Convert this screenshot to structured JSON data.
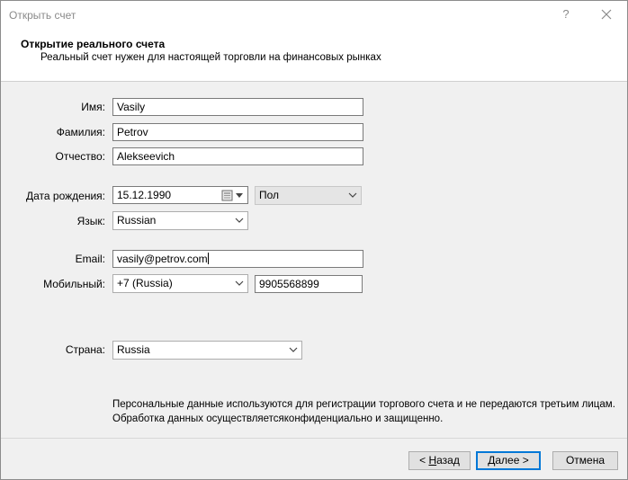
{
  "window": {
    "title": "Открыть счет",
    "help_label": "?",
    "close_icon": "close-icon"
  },
  "header": {
    "title": "Открытие реального счета",
    "subtitle": "Реальный счет нужен для настоящей торговли на финансовых рынках"
  },
  "form": {
    "first_name": {
      "label": "Имя:",
      "value": "Vasily"
    },
    "last_name": {
      "label": "Фамилия:",
      "value": "Petrov"
    },
    "patronymic": {
      "label": "Отчество:",
      "value": "Alekseevich"
    },
    "birth_date": {
      "label": "Дата рождения:",
      "value": "15.12.1990"
    },
    "gender": {
      "value": "Пол"
    },
    "language": {
      "label": "Язык:",
      "value": "Russian"
    },
    "email": {
      "label": "Email:",
      "value": "vasily@petrov.com"
    },
    "mobile": {
      "label": "Мобильный:",
      "country_code": "+7 (Russia)",
      "number": "9905568899"
    },
    "country": {
      "label": "Страна:",
      "value": "Russia"
    }
  },
  "note": {
    "line1": "Персональные данные используются для регистрации торгового счета и не передаются третьим лицам.",
    "line2": "Обработка данных осуществляетсяконфиденциально и защищенно."
  },
  "buttons": {
    "back_prefix": "< ",
    "back_mnemonic": "Н",
    "back_rest": "азад",
    "next": "Далее >",
    "cancel": "Отмена"
  }
}
